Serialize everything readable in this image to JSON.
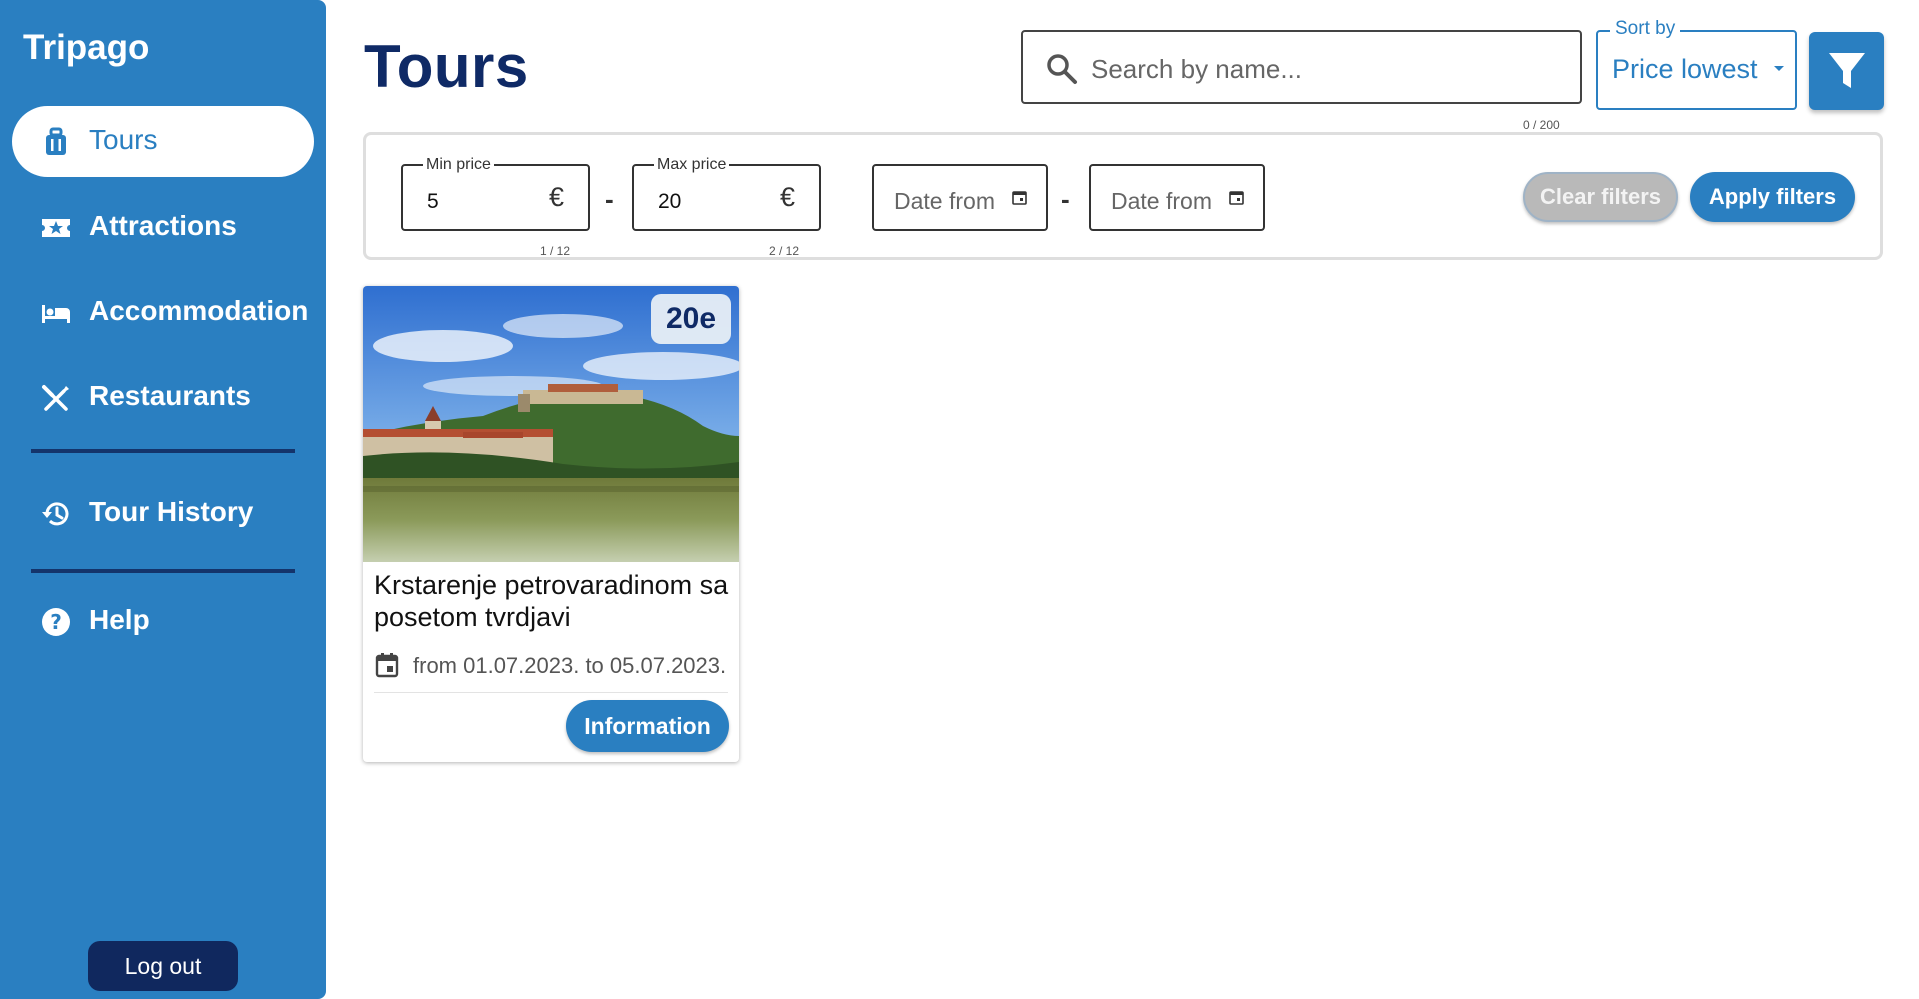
{
  "app": {
    "brand": "Tripago"
  },
  "sidebar": {
    "items": [
      {
        "label": "Tours",
        "icon": "luggage-icon",
        "active": true
      },
      {
        "label": "Attractions",
        "icon": "ticket-star-icon",
        "active": false
      },
      {
        "label": "Accommodation",
        "icon": "bed-icon",
        "active": false
      },
      {
        "label": "Restaurants",
        "icon": "utensils-icon",
        "active": false
      },
      {
        "label": "Tour History",
        "icon": "history-icon",
        "active": false
      },
      {
        "label": "Help",
        "icon": "help-circle-icon",
        "active": false
      }
    ],
    "logout_label": "Log out"
  },
  "header": {
    "title": "Tours",
    "search": {
      "placeholder": "Search by name...",
      "counter": "0 / 200"
    },
    "sort": {
      "label": "Sort by",
      "value": "Price lowest"
    },
    "filter_icon": "filter-icon"
  },
  "filters": {
    "min_price": {
      "label": "Min price",
      "value": "5",
      "currency": "€",
      "counter": "1 / 12"
    },
    "max_price": {
      "label": "Max price",
      "value": "20",
      "currency": "€",
      "counter": "2 / 12"
    },
    "range_separator": "-",
    "date_from_1": {
      "placeholder": "Date from"
    },
    "date_from_2": {
      "placeholder": "Date from"
    },
    "clear_label": "Clear filters",
    "apply_label": "Apply filters"
  },
  "tours": [
    {
      "price": "20e",
      "title": "Krstarenje petrovaradinom sa posetom tvrdjavi",
      "dates": "from 01.07.2023. to 05.07.2023.",
      "info_label": "Information"
    }
  ],
  "colors": {
    "primary": "#2a7fc1",
    "navy": "#0f2a66",
    "sidebar_divider": "#14346b",
    "clear_button": "#b9b9b9"
  }
}
